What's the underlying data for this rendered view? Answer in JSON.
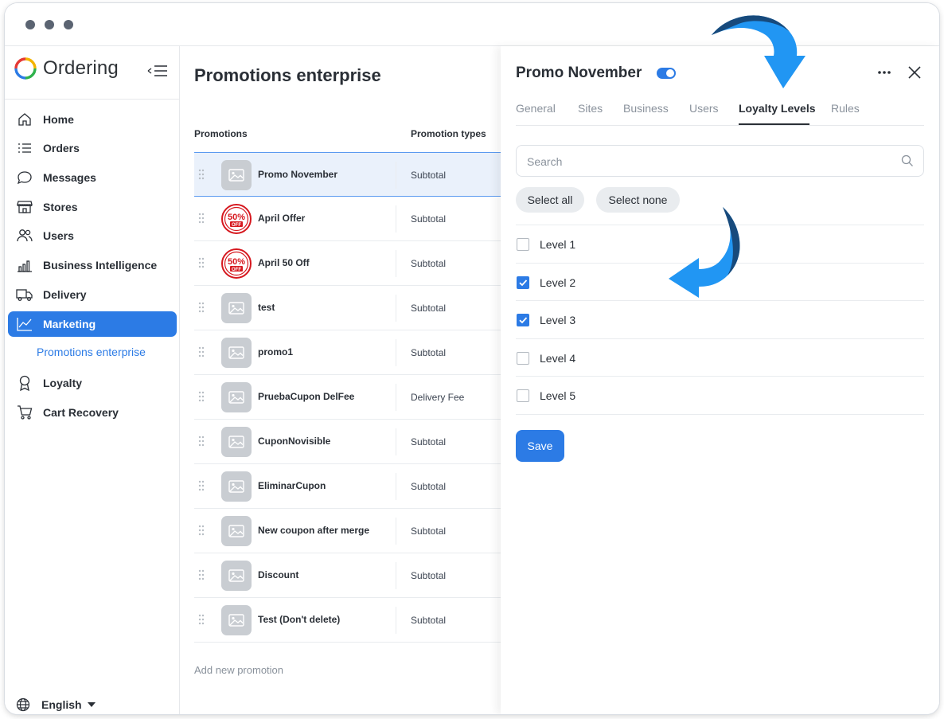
{
  "app": {
    "name": "Ordering"
  },
  "sidebar": {
    "items": [
      {
        "label": "Home",
        "icon": "home-icon"
      },
      {
        "label": "Orders",
        "icon": "list-icon"
      },
      {
        "label": "Messages",
        "icon": "chat-icon"
      },
      {
        "label": "Stores",
        "icon": "store-icon"
      },
      {
        "label": "Users",
        "icon": "users-icon"
      },
      {
        "label": "Business Intelligence",
        "icon": "bar-chart-icon"
      },
      {
        "label": "Delivery",
        "icon": "truck-icon"
      },
      {
        "label": "Marketing",
        "icon": "line-chart-icon",
        "active": true
      },
      {
        "label": "Loyalty",
        "icon": "award-icon"
      },
      {
        "label": "Cart Recovery",
        "icon": "cart-icon"
      }
    ],
    "sub_item": "Promotions enterprise",
    "language": "English"
  },
  "main": {
    "title": "Promotions enterprise",
    "columns": [
      "Promotions",
      "Promotion types"
    ],
    "rows": [
      {
        "name": "Promo November",
        "type": "Subtotal",
        "image": "placeholder"
      },
      {
        "name": "April Offer",
        "type": "Subtotal",
        "image": "50-off-badge"
      },
      {
        "name": "April 50 Off",
        "type": "Subtotal",
        "image": "50-off-badge"
      },
      {
        "name": "test",
        "type": "Subtotal",
        "image": "placeholder"
      },
      {
        "name": "promo1",
        "type": "Subtotal",
        "image": "placeholder"
      },
      {
        "name": "PruebaCupon DelFee",
        "type": "Delivery Fee",
        "image": "placeholder"
      },
      {
        "name": "CuponNovisible",
        "type": "Subtotal",
        "image": "placeholder"
      },
      {
        "name": "EliminarCupon",
        "type": "Subtotal",
        "image": "placeholder"
      },
      {
        "name": "New coupon after merge",
        "type": "Subtotal",
        "image": "placeholder"
      },
      {
        "name": "Discount",
        "type": "Subtotal",
        "image": "placeholder"
      },
      {
        "name": "Test (Don't delete)",
        "type": "Subtotal",
        "image": "placeholder"
      }
    ],
    "add_new": "Add new promotion"
  },
  "panel": {
    "title": "Promo November",
    "enabled": true,
    "tabs": [
      "General",
      "Sites",
      "Business",
      "Users",
      "Loyalty Levels",
      "Rules"
    ],
    "active_tab": "Loyalty Levels",
    "search_placeholder": "Search",
    "select_all": "Select all",
    "select_none": "Select none",
    "levels": [
      {
        "label": "Level 1",
        "checked": false
      },
      {
        "label": "Level 2",
        "checked": true
      },
      {
        "label": "Level 3",
        "checked": true
      },
      {
        "label": "Level 4",
        "checked": false
      },
      {
        "label": "Level 5",
        "checked": false
      }
    ],
    "save": "Save"
  },
  "badge_text": {
    "top": "50%",
    "bottom": "OFF"
  },
  "colors": {
    "accent": "#2c7be5",
    "arrow": "#2196f3",
    "arrow_shadow": "#174a7c",
    "badge_red": "#d6181f"
  }
}
